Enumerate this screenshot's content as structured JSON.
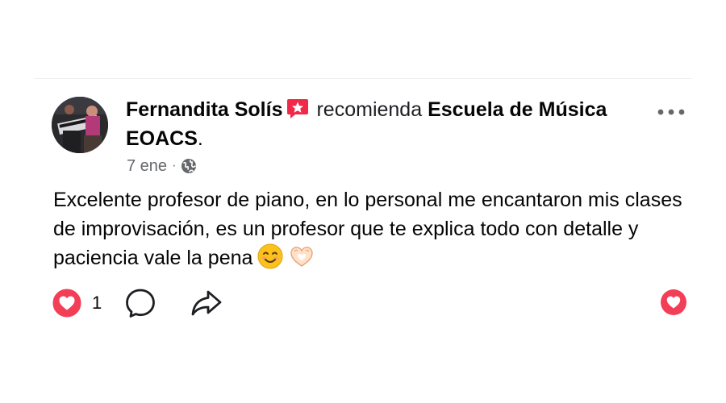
{
  "post": {
    "author_name": "Fernandita Solís",
    "verb": "recomienda",
    "page_name": "Escuela de Música EOACS",
    "period": ".",
    "date": "7 ene",
    "separator": "·",
    "privacy_icon": "globe-icon",
    "body": "Excelente profesor de piano, en lo personal me encantaron mis clases de improvisación, es un profesor que te explica todo con detalle y paciencia vale la pena",
    "emojis": [
      "smiling-face-emoji",
      "heart-hands-emoji"
    ]
  },
  "actions": {
    "reaction_count": "1",
    "reaction_icon": "love-reaction-icon",
    "comment_icon": "comment-icon",
    "share_icon": "share-icon"
  },
  "colors": {
    "reaction_red": "#f33e58",
    "muted_text": "#65676b",
    "recommend_pink": "#f02849",
    "divider": "#eceef1"
  }
}
